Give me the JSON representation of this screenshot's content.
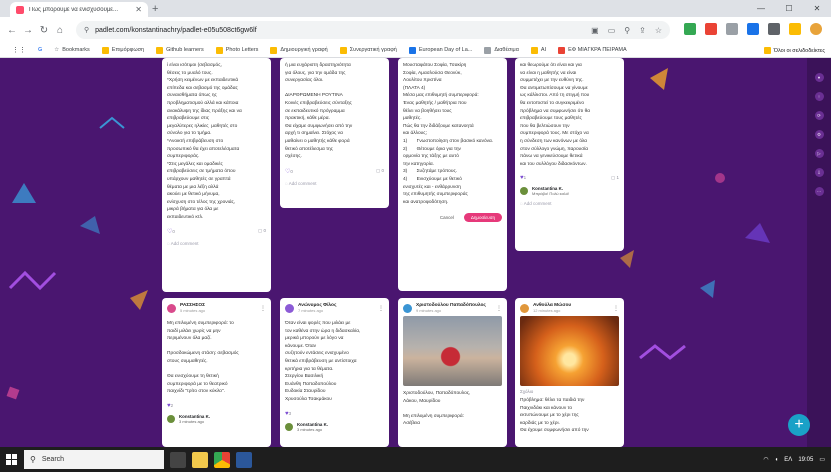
{
  "browser": {
    "tab_title": "Πώς μπορούμε να ενισχύσουμε...",
    "url": "padlet.com/konstantinachry/padlet-e05u508ct6gw6lf",
    "bookmarks": [
      {
        "label": "Bookmarks",
        "icon": "star-icon"
      },
      {
        "label": "Επιμόρφωση",
        "icon": "folder-icon"
      },
      {
        "label": "Github learners",
        "icon": "folder-icon"
      },
      {
        "label": "Photo Letters",
        "icon": "folder-icon"
      },
      {
        "label": "Δημιουργική γραφή",
        "icon": "folder-icon"
      },
      {
        "label": "Συνεργατική γραφή",
        "icon": "folder-icon"
      },
      {
        "label": "European Day of La...",
        "icon": "globe-icon"
      },
      {
        "label": "Διαθέσιμα",
        "icon": "page-icon"
      },
      {
        "label": "AI",
        "icon": "folder-icon"
      },
      {
        "label": "ΕΦ ΜΙΑΓΚΡΑ ΠΕΙΡΑΜΑ",
        "icon": "page-icon"
      }
    ],
    "all_bookmarks": "Όλοι οι σελιδοδείκτες"
  },
  "cards": {
    "c1": {
      "text": "ί είναι ισότιμοι (σεβασμός,\nθέσεις το μυαλό τους.\n*Χρήση κειμένων με εκπαιδευτικά\nεπίπεδα και σεβασμό της ομάδας\nσυναισθήματα όπως ης\nπροβληματισμού αλλά και κάποια\nανακάλυψη της ίδιας πράξης και να\nεπιβραβεύουμε στις\nμεγαλύτερες ηλικίες  μαθητές στο\nσύνολο για το τμήμα.\n*Ανοικτή επιβράβευση στο\nπροσωπικό θα έχει αποτελέσματα\nσυμπεριφοράς.\n*Στις μεγάλες και ομαδικές\nεπιβραβεύσεις σε τμήματα όπου\nυπάρχουν μαθητές σε γραπτά\nθέματα με μια λέξη αλλά\nακούει με θετικό μήνυμα,\nενίσχυση στο τέλος της χρονιάς,\nμικρά βήματα για όλα με\nεκπαιδευτικό κτλ.",
      "likes": "0",
      "comments": "0",
      "add_comment": "Add comment"
    },
    "c2": {
      "text": "ή μια ευχάριστη δραστηριότητα\nγια όλους, για την ομάδα της\nσυνεργασίας όλοι.\n\nΔΙΑΡΘΡΩΜΕΝΗ ΡΟΥΤΙΝΑ\nΚοινές επιβραβεύσεις σύνταξης\nσε εκπαιδευτικό πρόγραμμα\nπρακτική, κάθε μέρα.\nΘα είχαμε συμφωνήσει από την\nαρχή τι σημαίνει. Στόχος να\nμαθαίνει ο μαθητής κάθε φορά\nθετικό αποτέλεσμα της\nσχέσης.",
      "likes": "0",
      "comments": "0",
      "add_comment": "Add comment"
    },
    "c3": {
      "text": "Μουσταφάτου Σοφία, Τσακίρη\nΣοφία, Αμασλούσα Θεονύκ,\nΛουλίτου Χριστίνα\n(ΠΛΑΤΑ 4)\nΜέσα μας επιθυμητή συμπεριφορά:\nΈνας μαθητής / μαθήτρια που\nθέλει να βοηθήσει τους\nμαθητές.\nΠώς θα την διδάξουμε κατανοητά\nκαι άλλους;\n1)       Γνωστοποίηση στον βασικό κανόνα.\n2)       Θέτουμε όρια για την\nορμονία της τάξης με αυτό\nτην κατηγορία.\n3)       Συζητάμε τρόπους.\n4)       Ενισχύουμε με θετικό\nενισχυτές και - ενθάρρυνση\nτης επιθυμητής συμπεριφοράς\nκαι ανατροφοδότηση.",
      "cancel": "Cancel",
      "publish": "Δημοσίευση"
    },
    "c4": {
      "text": "και θεωρούμε ότι είναι και για\nνα είναι η μαθητής να είναι\nσυμμετέχει με την ευθύνη της.\nΘα αντιμετωπίσουμε να γίνουμε\nως κάλλιστοι. Από τη στιγμή που\nθα εντοπιστεί το συγκεκριμένο\nπρόβλημα να συμφωνήσει ότι θα\nεπιβραβεύουμε τους μαθητές\nπου θα βελτιώσουν την\nσυμπεριφορά τους. Με στόχο να\nη σύνδεση των κανόνων με όλα\nστον σύλλογο γνώμη, παρουσία\nπάνω να γενικεύσουμε θετικά\nκαι του συλλόγου διδασκόντων.",
      "likes": "1",
      "comments": "1",
      "comment_author": "Konstantina K.",
      "comment_text": "Μπράβο! Πολύ καλό!",
      "add_comment": "Add comment"
    },
    "c5": {
      "author": "ΡΑΣΣΗΣΟΣ",
      "time": "5 minutes ago",
      "text": "Μη επιλυμένη συμπεριφορά: το\nπαιδί μιλάει χωρίς να μην\nπεριμένουν όλα μαζί.\n\nΠροσδοκώμενη στάση: σεβασμός\nστους συμμαθητές.\n\nΘα ενισχύουμε τη θετική\nσυμπεριφορά με το θεατρικό\nπαιχνίδι \"τρίτο στον κύκλο\".",
      "likes": "2",
      "comment_author": "Konstantina K.",
      "comment_text": "3 minutes ago"
    },
    "c6": {
      "author": "Ανώνυμος Φίλος",
      "time": "7 minutes ago",
      "text": "Όταν είναι φορές που μιλάει με\nτον καθένα στην ώρα η διδασκαλία,\nμερικά μπορούν με λόγο να\nκάνουμε. Όταν\nσυζητούν εντάσεις ενισχυμένο\nθετικά επιβράβευση με αντίστοιχα\nκριτήρια για τα θέματα.\nΣτεργίου Βασιλική\nΕυάνθη Παπαδοπούλου\nΕυδοκία Σταυρίδου\nΧρυσούλα Τσακμάκου",
      "likes": "3",
      "comment_author": "Konstantina K.",
      "comment_text": "3 minutes ago"
    },
    "c7": {
      "author": "Χριστοδούλου Παπαδόπουλος",
      "time": "9 minutes ago",
      "text": "Χριστοδούλου, Παπαδόπουλος,\nΛάκου, Μαυρίδου\n\nΜη επιλυμένη συμπεριφορά:\nΑσέβεια"
    },
    "c8": {
      "author": "Ανθούλα Μώσου",
      "time": "12 minutes ago",
      "status": "Σχόλιο",
      "text": "Πρόβλημα: θέλει τα παιδιά την\nΠαιχνιδάκι και κάνουν το\nεκτυπώνουμε με το χέρι της\nκαρδιάς με το χέρι.\nΘα έχουμε συμφωνήσει από την"
    }
  },
  "taskbar": {
    "search": "Search",
    "lang": "ΕΛ",
    "time": "19:05"
  },
  "colors": {
    "padlet_bg": "#4a1670",
    "publish": "#e6397a",
    "fab": "#1aa1c7"
  }
}
